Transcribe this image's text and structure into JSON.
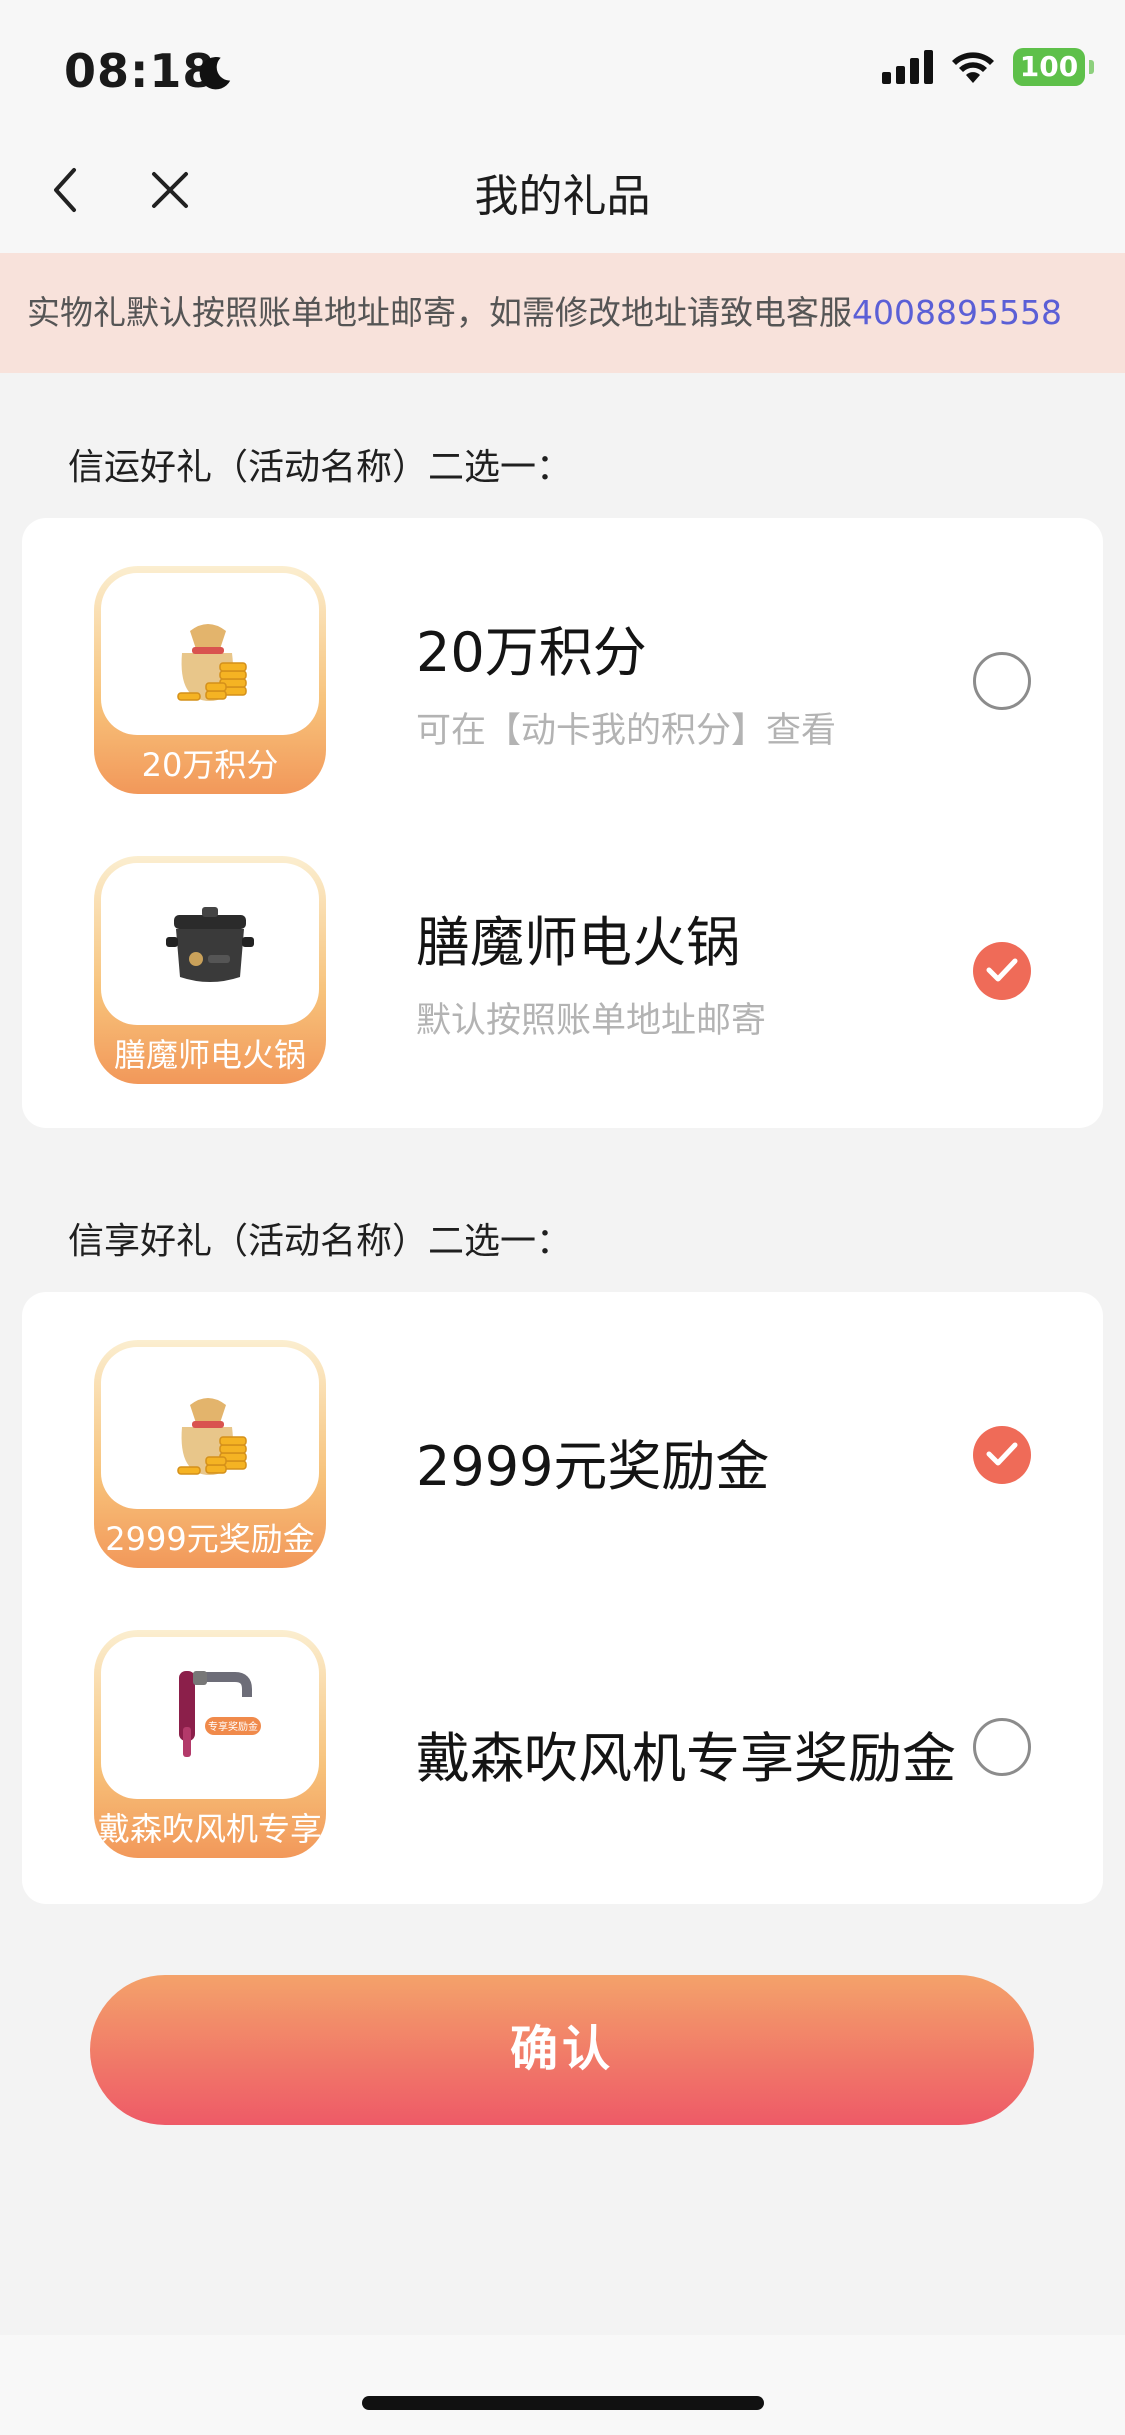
{
  "status_bar": {
    "time": "08:18",
    "battery": "100"
  },
  "header": {
    "title": "我的礼品"
  },
  "notice": {
    "text": "实物礼默认按照账单地址邮寄，如需修改地址请致电客服",
    "phone": "4008895558"
  },
  "sections": [
    {
      "title": "信运好礼（活动名称）二选一：",
      "options": [
        {
          "thumb_label": "20万积分",
          "title": "20万积分",
          "subtitle": "可在【动卡我的积分】查看",
          "checked": false,
          "image": "money-bag-coins"
        },
        {
          "thumb_label": "膳魔师电火锅",
          "title": "膳魔师电火锅",
          "subtitle": "默认按照账单地址邮寄",
          "checked": true,
          "image": "electric-hotpot"
        }
      ]
    },
    {
      "title": "信享好礼（活动名称）二选一：",
      "options": [
        {
          "thumb_label": "2999元奖励金",
          "title": "2999元奖励金",
          "subtitle": "",
          "checked": true,
          "image": "money-bag-coins"
        },
        {
          "thumb_label": "戴森吹风机专享",
          "title": "戴森吹风机专享奖励金",
          "subtitle": "",
          "checked": false,
          "image": "hair-dryer",
          "badge": "专享奖励金"
        }
      ]
    }
  ],
  "confirm_label": "确认",
  "colors": {
    "accent": "#ef6b58",
    "notice_bg": "#f8e2db",
    "phone_link": "#5b5fd6"
  }
}
